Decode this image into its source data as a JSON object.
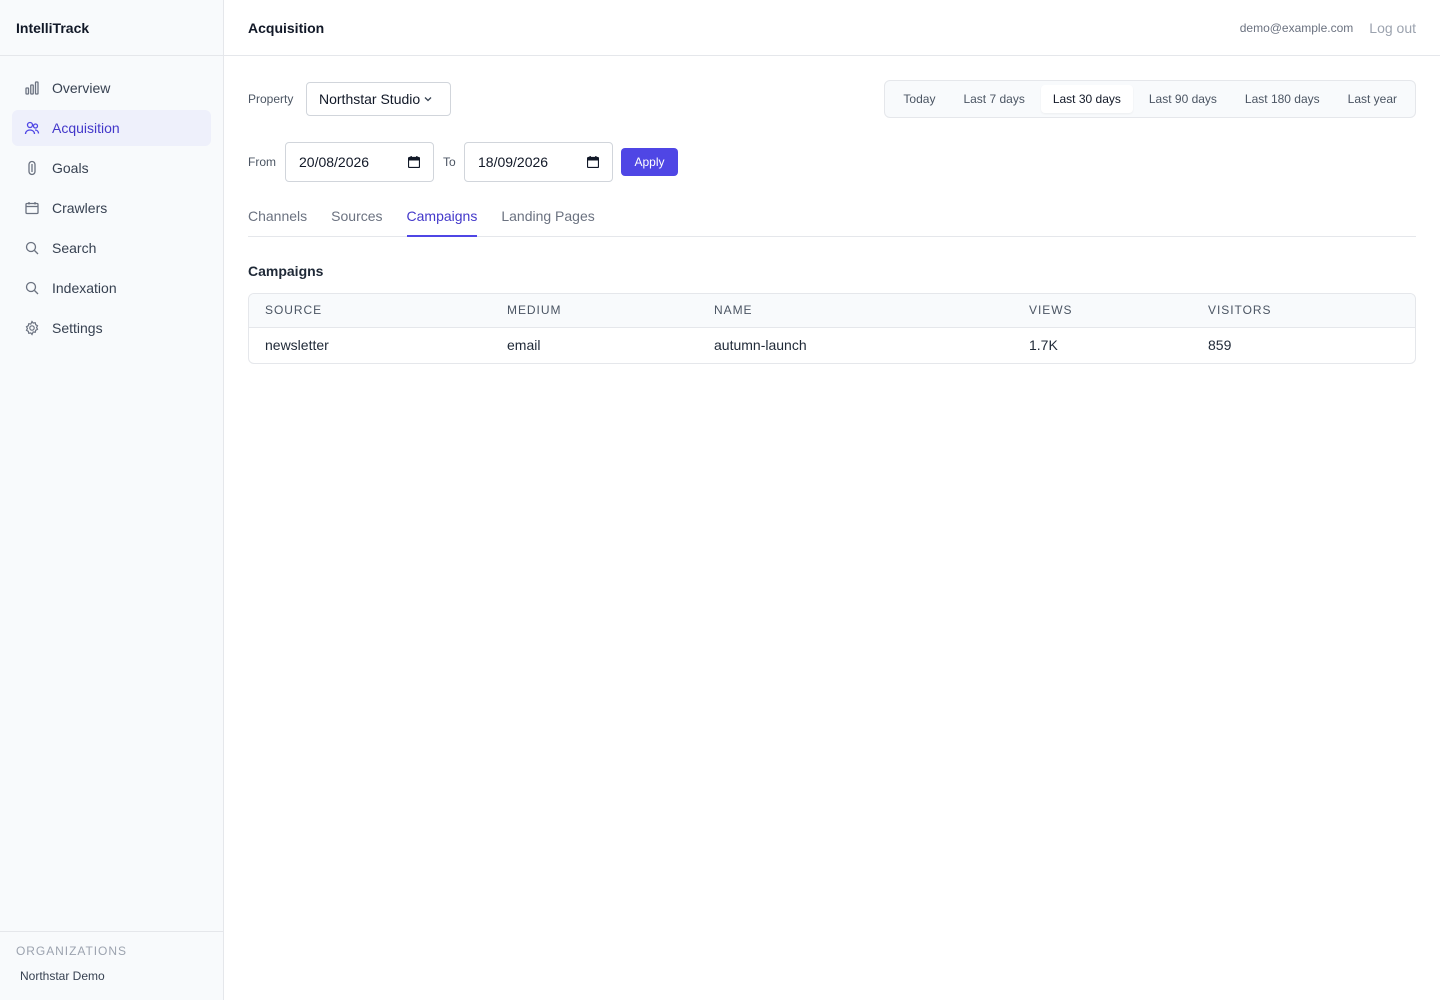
{
  "app": {
    "name": "IntelliTrack"
  },
  "sidebar": {
    "items": [
      {
        "label": "Overview",
        "icon": "bar-chart-icon"
      },
      {
        "label": "Acquisition",
        "icon": "users-icon",
        "active": true
      },
      {
        "label": "Goals",
        "icon": "goal-icon"
      },
      {
        "label": "Crawlers",
        "icon": "calendar-icon"
      },
      {
        "label": "Search",
        "icon": "search-icon"
      },
      {
        "label": "Indexation",
        "icon": "search-icon"
      },
      {
        "label": "Settings",
        "icon": "gear-icon"
      }
    ],
    "org_label": "ORGANIZATIONS",
    "org_name": "Northstar Demo"
  },
  "header": {
    "title": "Acquisition",
    "user_email": "demo@example.com",
    "logout": "Log out"
  },
  "filters": {
    "property_label": "Property",
    "property_value": "Northstar Studio",
    "ranges": [
      "Today",
      "Last 7 days",
      "Last 30 days",
      "Last 90 days",
      "Last 180 days",
      "Last year"
    ],
    "active_range": "Last 30 days",
    "from_label": "From",
    "from_value": "20/08/2026",
    "to_label": "To",
    "to_value": "18/09/2026",
    "apply_label": "Apply"
  },
  "tabs": {
    "items": [
      "Channels",
      "Sources",
      "Campaigns",
      "Landing Pages"
    ],
    "active": "Campaigns"
  },
  "campaigns": {
    "title": "Campaigns",
    "columns": [
      "SOURCE",
      "MEDIUM",
      "NAME",
      "VIEWS",
      "VISITORS"
    ],
    "rows": [
      [
        "newsletter",
        "email",
        "autumn-launch",
        "1.7K",
        "859"
      ]
    ]
  },
  "colors": {
    "accent": "#4f46e5",
    "accent_text": "#4338ca",
    "sidebar_bg": "#f8fafc",
    "border": "#e5e7eb"
  }
}
